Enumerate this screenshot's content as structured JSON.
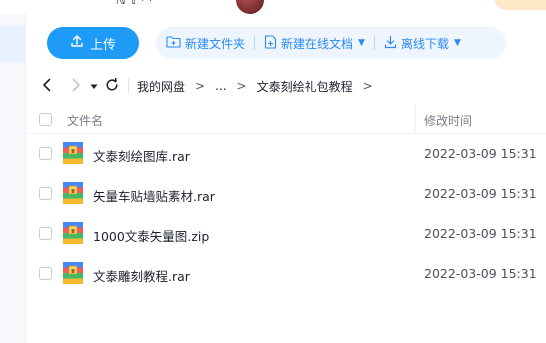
{
  "toolbar": {
    "upload_label": "上传",
    "new_folder_label": "新建文件夹",
    "new_doc_label": "新建在线文档",
    "offline_download_label": "离线下载"
  },
  "breadcrumb": {
    "root": "我的网盘",
    "sep": ">",
    "ellipsis": "...",
    "current": "文泰刻绘礼包教程"
  },
  "table": {
    "header_name": "文件名",
    "header_time": "修改时间",
    "files": [
      {
        "name": "文泰刻绘图库.rar",
        "time": "2022-03-09 15:31"
      },
      {
        "name": "矢量车贴墙贴素材.rar",
        "time": "2022-03-09 15:31"
      },
      {
        "name": "1000文泰矢量图.zip",
        "time": "2022-03-09 15:31"
      },
      {
        "name": "文泰雕刻教程.rar",
        "time": "2022-03-09 15:31"
      }
    ]
  },
  "colors": {
    "accent": "#1e9bf7",
    "link": "#2a8cf0",
    "toolbar_bg": "#eef5ff"
  },
  "icons": {
    "upload": "upload-icon",
    "new_folder": "folder-plus-icon",
    "new_doc": "document-plus-icon",
    "offline_download": "download-icon",
    "back": "chevron-left-icon",
    "forward": "chevron-right-icon",
    "history": "caret-down-icon",
    "refresh": "refresh-icon",
    "archive": "archive-file-icon"
  }
}
